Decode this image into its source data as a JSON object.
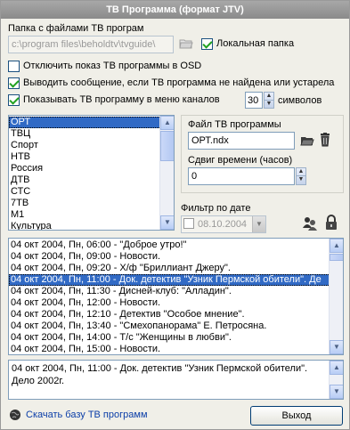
{
  "window": {
    "title": "ТВ Программа (формат JTV)"
  },
  "folder": {
    "label": "Папка с файлами ТВ програм",
    "path": "c:\\program files\\beholdtv\\tvguide\\",
    "local_label": "Локальная папка",
    "local_checked": true
  },
  "options": {
    "disable_osd": {
      "label": "Отключить показ ТВ программы в OSD",
      "checked": false
    },
    "show_message": {
      "label": "Выводить сообщение, если ТВ программа не найдена или устарела",
      "checked": true
    },
    "show_in_menu": {
      "label": "Показывать ТВ программу в меню каналов",
      "checked": true
    },
    "chars_value": "30",
    "chars_label": "символов"
  },
  "channels": {
    "items": [
      "ОРТ",
      "ТВЦ",
      "Спорт",
      "НТВ",
      "Россия",
      "ДТВ",
      "СТС",
      "7ТВ",
      "М1",
      "Культура"
    ],
    "selected_index": 0
  },
  "file_panel": {
    "file_label": "Файл ТВ программы",
    "file_value": "ОРТ.ndx",
    "shift_label": "Сдвиг времени (часов)",
    "shift_value": "0"
  },
  "filter": {
    "label": "Фильтр по дате",
    "date_value": "08.10.2004",
    "date_checked": false
  },
  "programs": {
    "items": [
      "04 окт 2004, Пн, 06:00 - \"Доброе утро!\"",
      "04 окт 2004, Пн, 09:00 - Новости.",
      "04 окт 2004, Пн, 09:20 - Х/ф \"Бриллиант Джеру\".",
      "04 окт 2004, Пн, 11:00 - Док. детектив \"Узник Пермской обители\". Де",
      "04 окт 2004, Пн, 11:30 - Дисней-клуб: \"Алладин\".",
      "04 окт 2004, Пн, 12:00 - Новости.",
      "04 окт 2004, Пн, 12:10 - Детектив \"Особое мнение\".",
      "04 окт 2004, Пн, 13:40 - \"Смехопанорама\" Е. Петросяна.",
      "04 окт 2004, Пн, 14:00 - Т/с \"Женщины в любви\".",
      "04 окт 2004, Пн, 15:00 - Новости."
    ],
    "selected_index": 3
  },
  "details": {
    "line1": "04 окт 2004, Пн, 11:00 - Док. детектив \"Узник Пермской обители\".",
    "line2": "Дело 2002г."
  },
  "footer": {
    "download_link": "Скачать базу ТВ программ",
    "exit_button": "Выход"
  }
}
